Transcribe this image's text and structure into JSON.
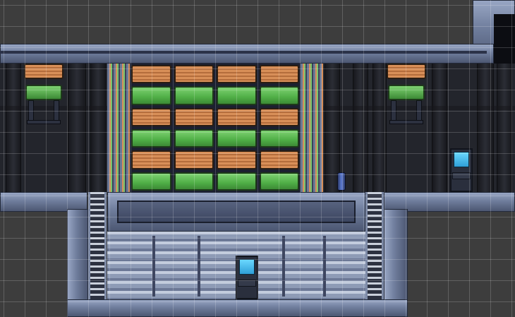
{
  "editor": {
    "grid_visible": true,
    "grid_color": "#ffffff",
    "empty_cell_color": "#3d3d3d"
  },
  "palette": {
    "crate_orange": "#d88f58",
    "crate_green": "#5fbf55",
    "steel": "#7f8cab",
    "corridor": "#23252c",
    "screen": "#4fc3f7"
  },
  "scene": {
    "rooms": [
      "upper-cargo-corridor",
      "lower-tank-room",
      "top-right-doorway"
    ],
    "cargo_shelf": {
      "columns": 4,
      "row_colors": [
        "orange",
        "green",
        "orange",
        "green",
        "orange",
        "green"
      ]
    },
    "terminals": [
      "terminal-corridor",
      "terminal-tank-room"
    ],
    "ladders": [
      "ladder-left",
      "ladder-right"
    ],
    "loaders": [
      "cargo-loader-left",
      "cargo-loader-right"
    ],
    "props": [
      "canister"
    ]
  }
}
